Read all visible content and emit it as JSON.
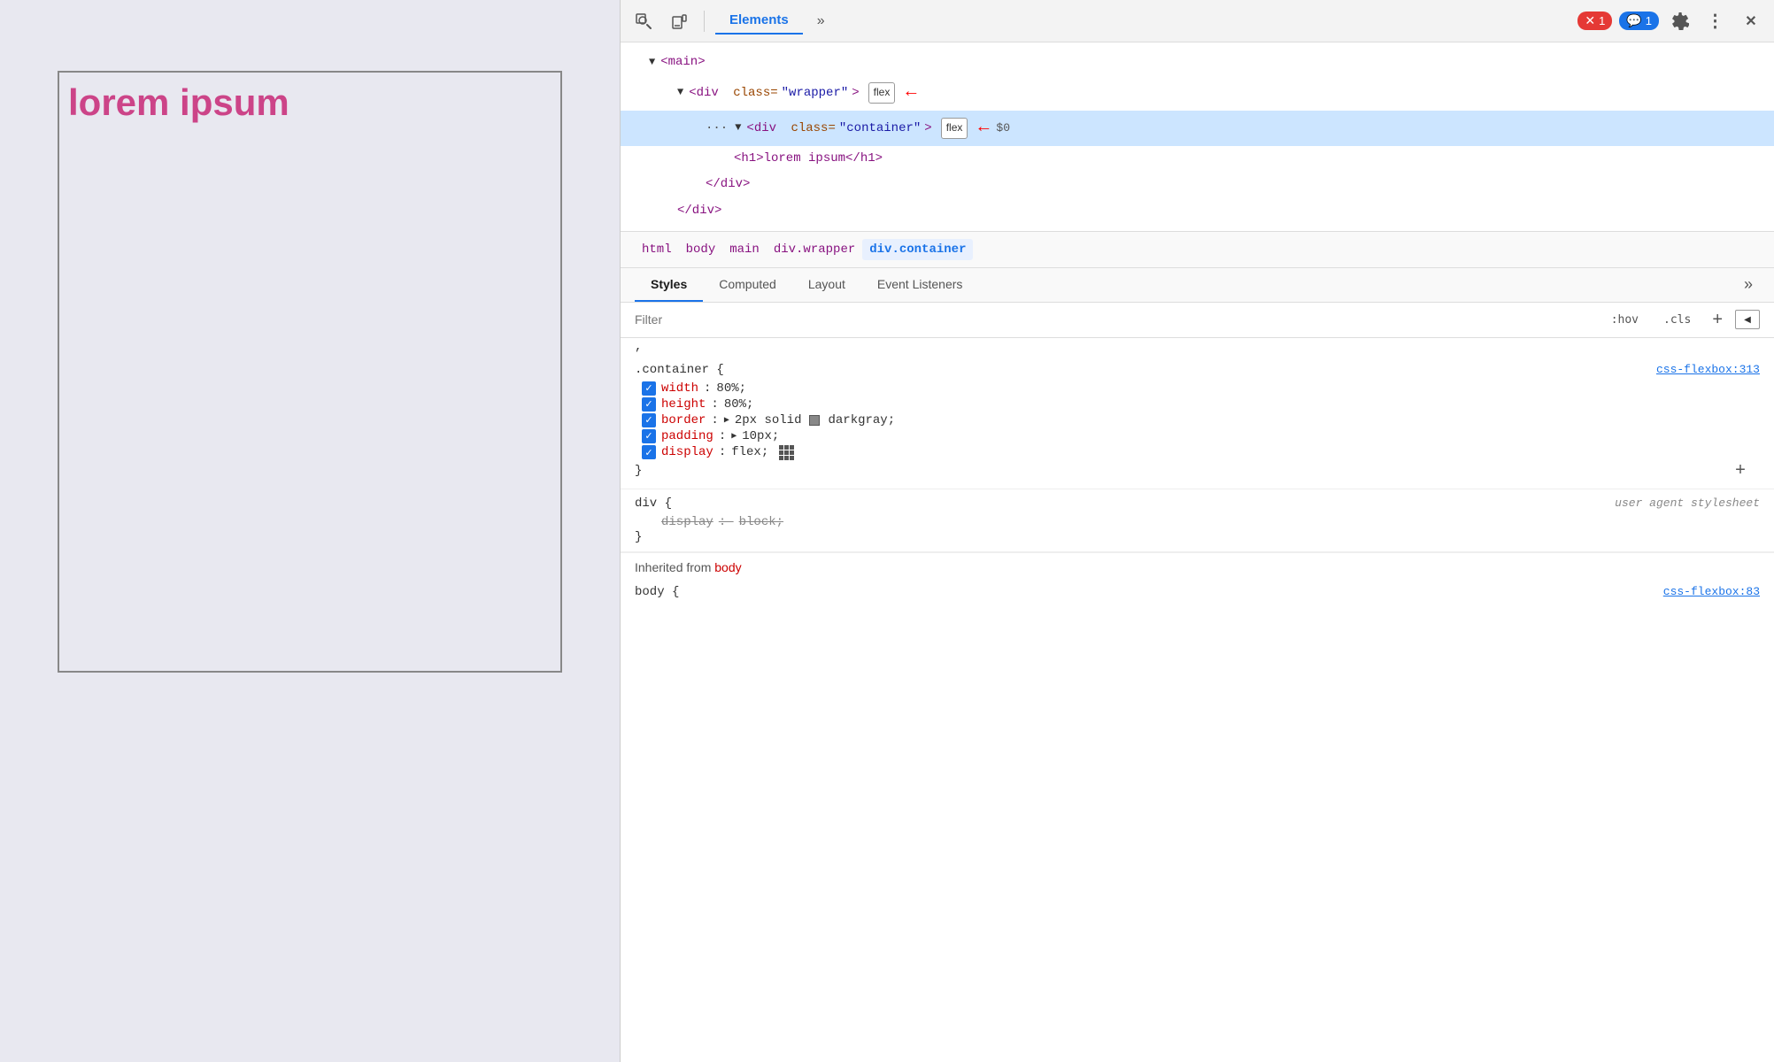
{
  "webpage": {
    "lorem_text": "lorem ipsum"
  },
  "devtools": {
    "toolbar": {
      "inspect_icon": "⊡",
      "device_icon": "▭",
      "elements_tab": "Elements",
      "more_tabs": "»",
      "error_badge": "1",
      "message_badge": "1",
      "settings_icon": "⚙",
      "more_menu": "⋮",
      "close_icon": "✕"
    },
    "html_tree": {
      "main_tag": "<main>",
      "wrapper_tag": "<div class=\"wrapper\">",
      "wrapper_flex_badge": "flex",
      "container_tag": "<div class=\"container\">",
      "container_flex_badge": "flex",
      "h1_tag": "<h1>lorem ipsum</h1>",
      "close_div": "</div>",
      "close_div2": "</div>"
    },
    "breadcrumb": {
      "items": [
        "html",
        "body",
        "main",
        "div.wrapper",
        "div.container"
      ]
    },
    "sub_tabs": {
      "items": [
        "Styles",
        "Computed",
        "Layout",
        "Event Listeners"
      ],
      "active": "Styles",
      "more": "»"
    },
    "filter": {
      "placeholder": "Filter",
      "hov_btn": ":hov",
      "cls_btn": ".cls",
      "add_btn": "+",
      "force_btn": "◀"
    },
    "styles": {
      "partial_line": ",",
      "rule1": {
        "selector": ".container {",
        "source": "css-flexbox:313",
        "props": [
          {
            "checked": true,
            "name": "width",
            "value": "80%;"
          },
          {
            "checked": true,
            "name": "height",
            "value": "80%;"
          },
          {
            "checked": true,
            "name": "border",
            "value": "▶ 2px solid",
            "has_swatch": true,
            "swatch_color": "#888",
            "extra": "darkgray;"
          },
          {
            "checked": true,
            "name": "padding",
            "value": "▶ 10px;"
          },
          {
            "checked": true,
            "name": "display",
            "value": "flex;",
            "has_flex_icon": true
          }
        ],
        "close": "}"
      },
      "add_icon": "+",
      "rule2": {
        "selector": "div {",
        "source_label": "user agent stylesheet",
        "props": [
          {
            "strikethrough": true,
            "name": "display",
            "value": "block;"
          }
        ],
        "close": "}"
      },
      "inherited_label": "Inherited from",
      "inherited_element": "body",
      "rule3": {
        "selector": "body {",
        "source": "css-flexbox:83"
      }
    }
  }
}
